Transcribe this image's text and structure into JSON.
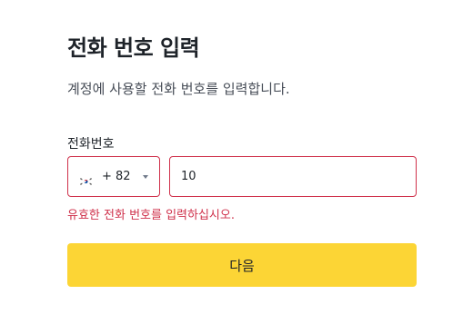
{
  "header": {
    "title": "전화 번호 입력",
    "subtitle": "계정에 사용할 전화 번호를 입력합니다."
  },
  "phone_field": {
    "label": "전화번호",
    "country": {
      "flag_icon": "south-korea-flag-icon",
      "dial_code": "+ 82",
      "dropdown_icon": "caret-down-icon"
    },
    "value": "10",
    "error": "유효한 전화 번호를 입력하십시오."
  },
  "actions": {
    "next_label": "다음"
  },
  "colors": {
    "accent": "#fcd535",
    "error": "#cf304a",
    "text_primary": "#1e2329",
    "text_secondary": "#474d57"
  }
}
